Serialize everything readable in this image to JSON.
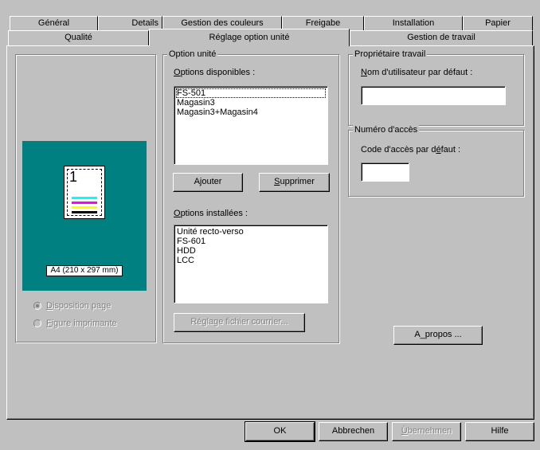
{
  "tabs_back": [
    {
      "label": "Général"
    },
    {
      "label": "Details"
    },
    {
      "label": "Gestion des couleurs"
    },
    {
      "label": "Freigabe"
    },
    {
      "label": "Installation"
    },
    {
      "label": "Papier"
    }
  ],
  "tabs_front": [
    {
      "label": "Qualité"
    },
    {
      "label": "Réglage option unité",
      "active": true
    },
    {
      "label": "Gestion de travail"
    }
  ],
  "preview": {
    "page_number": "1",
    "paper_label": "A4 (210 x 297 mm)",
    "stripe_colors": [
      "#00ffff",
      "#ff00ff",
      "#ffff00",
      "#000000"
    ]
  },
  "radios": [
    {
      "label": "Disposition page",
      "underline": "D",
      "rest": "isposition page",
      "checked": true
    },
    {
      "label": "Figure imprimante",
      "underline": "F",
      "rest": "igure imprimante",
      "checked": false
    }
  ],
  "option_unite": {
    "title": "Option unité",
    "available_label_u": "O",
    "available_label_rest": "ptions disponibles :",
    "available_items": [
      "FS-501",
      "Magasin3",
      "Magasin3+Magasin4"
    ],
    "add_button": "Ajouter",
    "remove_button_u": "S",
    "remove_button_rest": "upprimer",
    "installed_label_u": "O",
    "installed_label_rest": "ptions installées :",
    "installed_items": [
      "Unité recto-verso",
      "FS-601",
      "HDD",
      "LCC"
    ],
    "mail_file_button": "Réglage fichier courrier..."
  },
  "proprietaire": {
    "title": "Propriétaire travail",
    "label_u": "N",
    "label_rest": "om d'utilisateur par défaut :",
    "value": ""
  },
  "acces": {
    "title": "Numéro d'accès",
    "label_pre": "Code d'accès par d",
    "label_u": "é",
    "label_rest": "faut :",
    "value": ""
  },
  "about_button_pre": "A",
  "about_button_u": "_",
  "about_button_rest": "propos ...",
  "footer": {
    "ok": "OK",
    "cancel": "Abbrechen",
    "apply_u": "Ü",
    "apply_rest": "bernehmen",
    "help": "Hilfe"
  }
}
